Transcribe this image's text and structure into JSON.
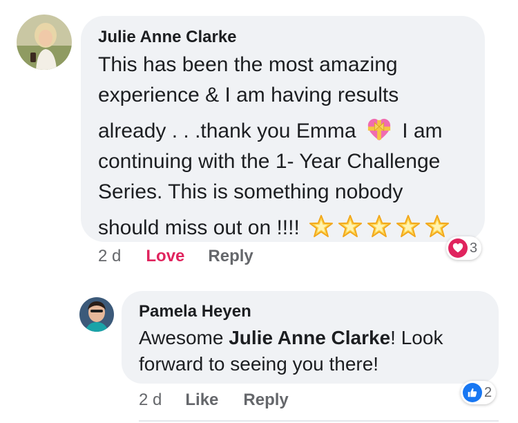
{
  "comment": {
    "author": "Julie Anne Clarke",
    "lines": [
      "This has been the most amazing",
      "experience & I am having results",
      "already . . .thank you Emma",
      "I am",
      "continuing with the 1- Year Challenge",
      "Series. This is something nobody",
      "should miss out on !!!!"
    ],
    "time": "2 d",
    "love_label": "Love",
    "reply_label": "Reply",
    "reaction_count": "3",
    "reaction_icon": "heart-icon",
    "emoji_icons": [
      "heart-with-ribbon-icon",
      "glowing-star-icon"
    ],
    "star_count": 5
  },
  "reply": {
    "author": "Pamela Heyen",
    "text_before": "Awesome ",
    "mention": "Julie Anne Clarke",
    "text_after": "! Look",
    "line2": "forward to seeing you there!",
    "time": "2 d",
    "like_label": "Like",
    "reply_label": "Reply",
    "reaction_count": "2",
    "reaction_icon": "thumbs-up-icon"
  },
  "colors": {
    "bubble": "#f0f2f5",
    "love": "#e0245e",
    "like": "#1877f2",
    "muted": "#65676b"
  }
}
